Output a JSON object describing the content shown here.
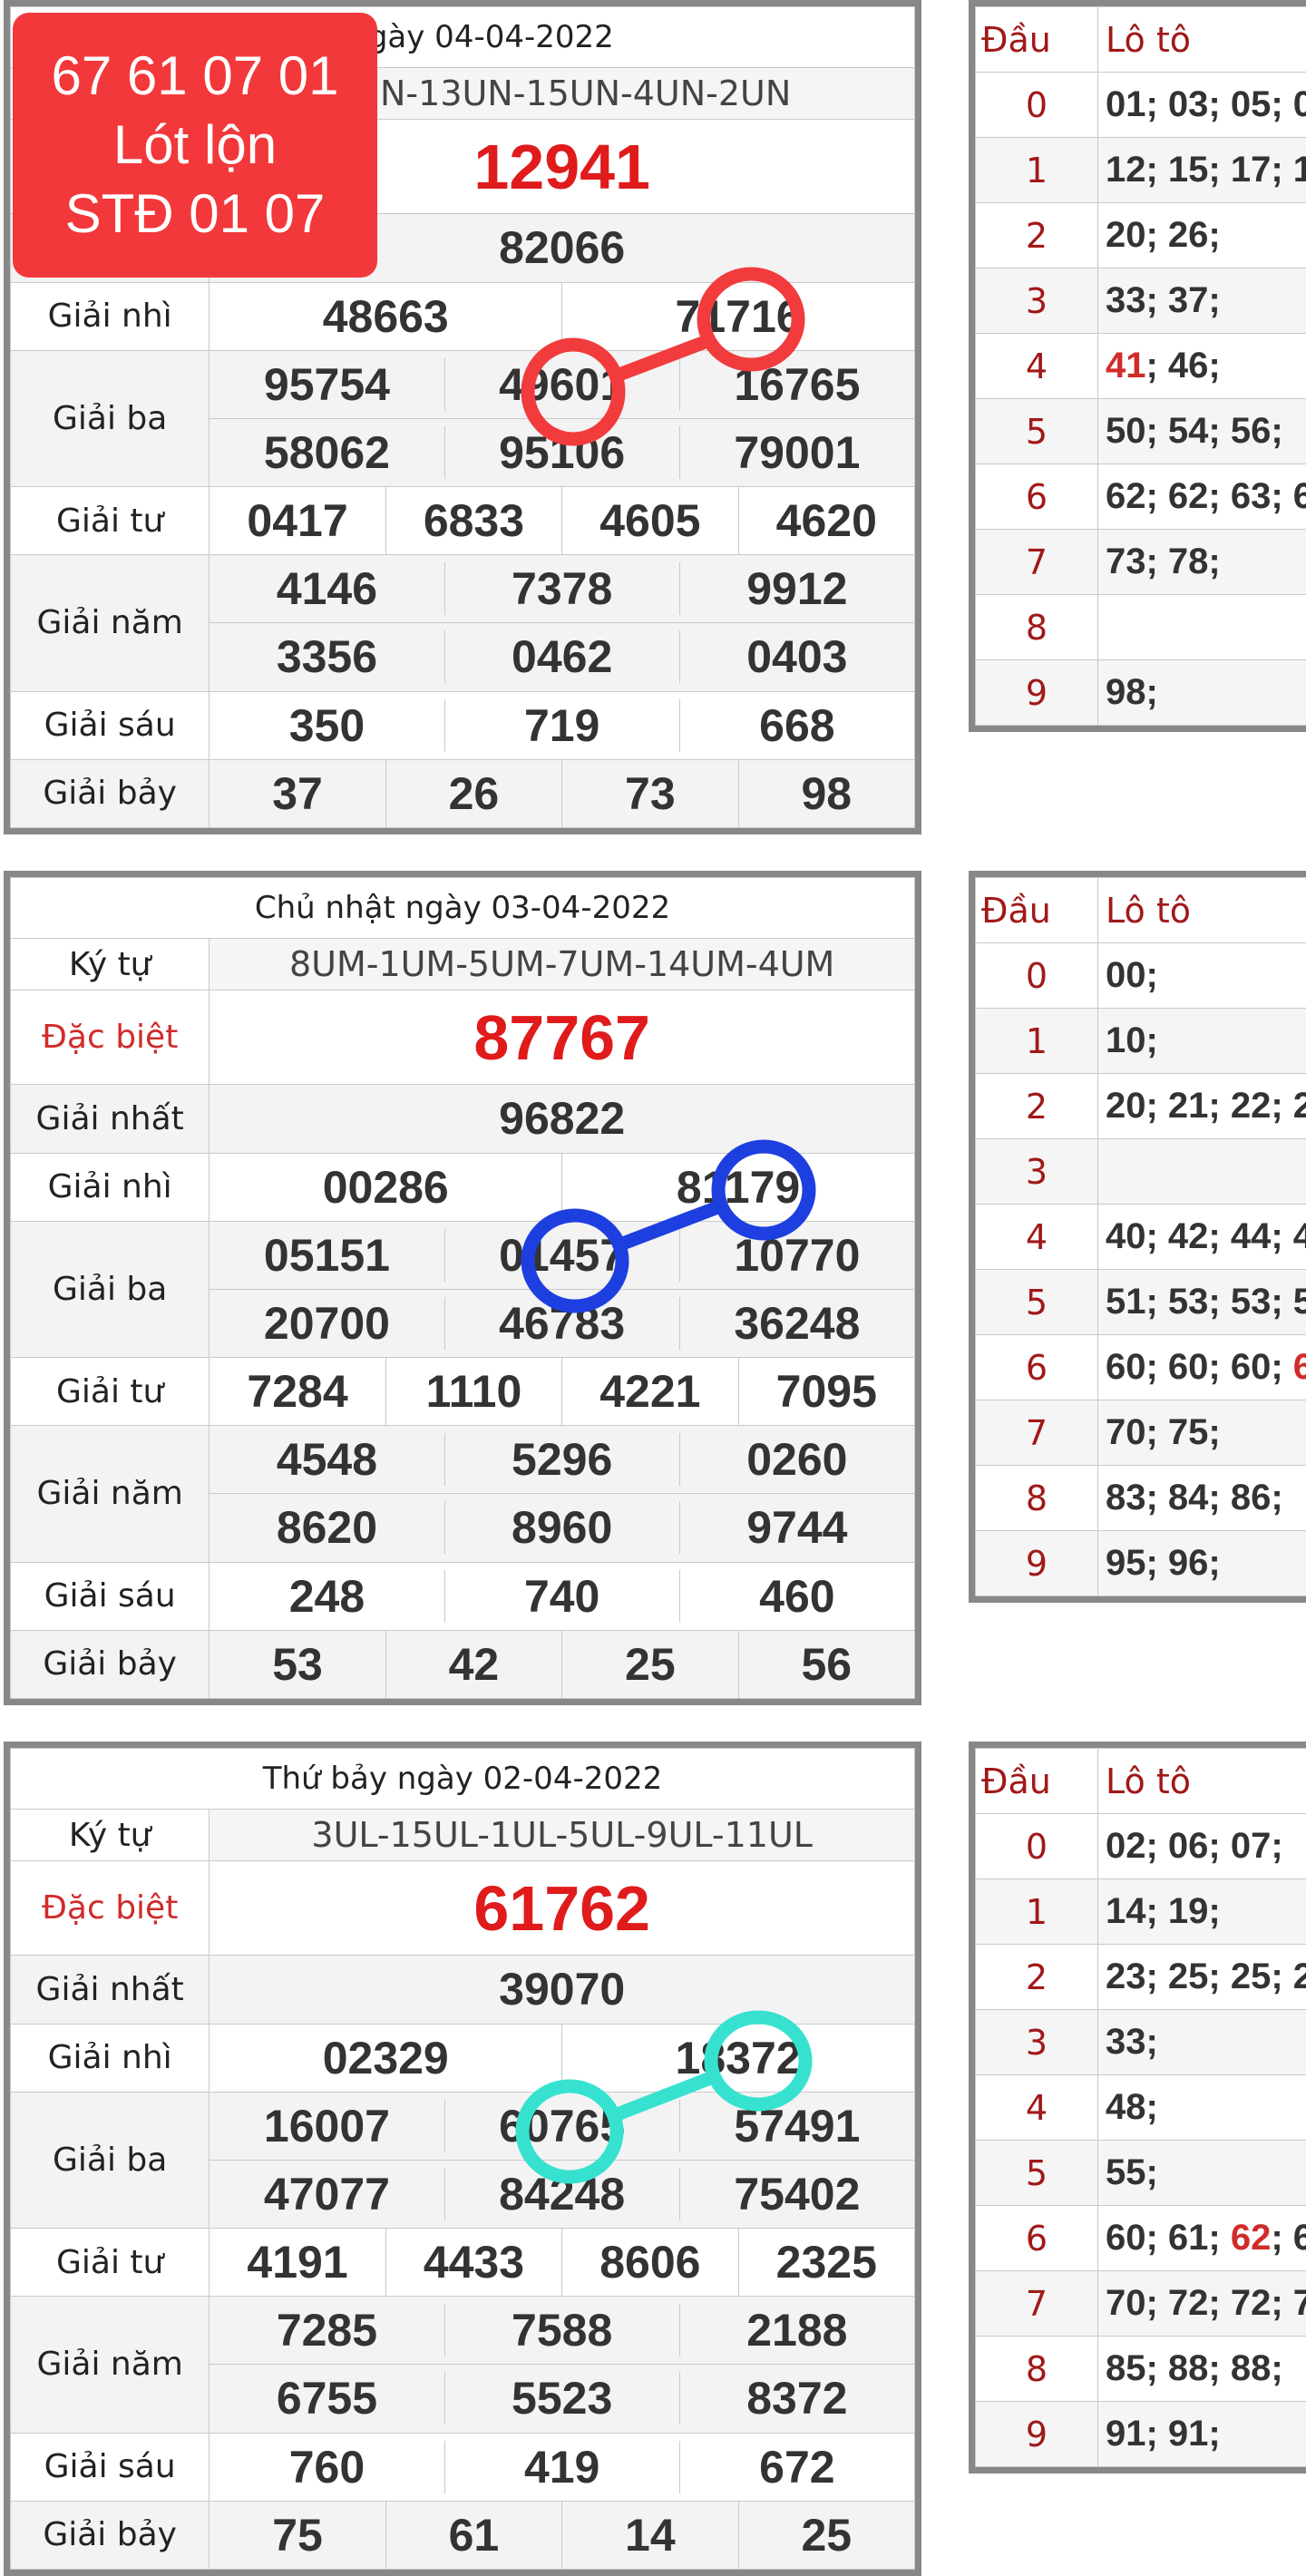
{
  "promo": {
    "line1": "67 61 07 01",
    "line2": "Lót lộn",
    "line3": "STĐ 01 07"
  },
  "labels": {
    "ky_tu": "Ký tự",
    "dac_biet": "Đặc biệt",
    "giai_nhat": "Giải nhất",
    "giai_nhi": "Giải nhì",
    "giai_ba": "Giải ba",
    "giai_tu": "Giải tư",
    "giai_nam": "Giải năm",
    "giai_sau": "Giải sáu",
    "giai_bay": "Giải bảy",
    "dau": "Đầu",
    "loto": "Lô tô"
  },
  "colors": {
    "circle_1": "#f23b3d",
    "circle_2": "#1e3fe0",
    "circle_3": "#36e2cf",
    "special": "#e01b1b",
    "label_red": "#d12b2b"
  },
  "draws": [
    {
      "title": "ai ngày 04-04-2022",
      "ky_tu": "8UN-13UN-15UN-4UN-2UN",
      "dac_biet": "12941",
      "giai_nhat": "82066",
      "giai_nhi": [
        "48663",
        "71716"
      ],
      "giai_ba": [
        "95754",
        "49601",
        "16765",
        "58062",
        "95106",
        "79001"
      ],
      "giai_tu": [
        "0417",
        "6833",
        "4605",
        "4620"
      ],
      "giai_nam": [
        "4146",
        "7378",
        "9912",
        "3356",
        "0462",
        "0403"
      ],
      "giai_sau": [
        "350",
        "719",
        "668"
      ],
      "giai_bay": [
        "37",
        "26",
        "73",
        "98"
      ],
      "loto": [
        "01; 03; 05; 0",
        "12; 15; 17; 1",
        "20; 26;",
        "33; 37;",
        "41; 46;",
        "50; 54; 56;",
        "62; 62; 63; 6",
        "73; 78;",
        "",
        "98;"
      ],
      "loto_hl": [
        "",
        "",
        "",
        "",
        "41",
        "",
        "",
        "",
        "",
        ""
      ],
      "loto_rest": [
        "",
        "",
        "",
        "",
        "; 46;",
        "",
        "",
        "",
        "",
        ""
      ]
    },
    {
      "title": "Chủ nhật ngày 03-04-2022",
      "ky_tu": "8UM-1UM-5UM-7UM-14UM-4UM",
      "dac_biet": "87767",
      "giai_nhat": "96822",
      "giai_nhi": [
        "00286",
        "81179"
      ],
      "giai_ba": [
        "05151",
        "01457",
        "10770",
        "20700",
        "46783",
        "36248"
      ],
      "giai_tu": [
        "7284",
        "1110",
        "4221",
        "7095"
      ],
      "giai_nam": [
        "4548",
        "5296",
        "0260",
        "8620",
        "8960",
        "9744"
      ],
      "giai_sau": [
        "248",
        "740",
        "460"
      ],
      "giai_bay": [
        "53",
        "42",
        "25",
        "56"
      ],
      "loto": [
        "00;",
        "10;",
        "20; 21; 22; 2",
        "",
        "40; 42; 44; 4",
        "51; 53; 53; 5",
        "60; 60; 60; ",
        "70; 75;",
        "83; 84; 86;",
        "95; 96;"
      ],
      "loto_hl": [
        "",
        "",
        "",
        "",
        "",
        "",
        "6",
        "",
        "",
        ""
      ],
      "loto_rest": [
        "",
        "",
        "",
        "",
        "",
        "",
        "",
        "",
        "",
        ""
      ]
    },
    {
      "title": "Thứ bảy ngày 02-04-2022",
      "ky_tu": "3UL-15UL-1UL-5UL-9UL-11UL",
      "dac_biet": "61762",
      "giai_nhat": "39070",
      "giai_nhi": [
        "02329",
        "18372"
      ],
      "giai_ba": [
        "16007",
        "60765",
        "57491",
        "47077",
        "84248",
        "75402"
      ],
      "giai_tu": [
        "4191",
        "4433",
        "8606",
        "2325"
      ],
      "giai_nam": [
        "7285",
        "7588",
        "2188",
        "6755",
        "5523",
        "8372"
      ],
      "giai_sau": [
        "760",
        "419",
        "672"
      ],
      "giai_bay": [
        "75",
        "61",
        "14",
        "25"
      ],
      "loto": [
        "02; 06; 07;",
        "14; 19;",
        "23; 25; 25; 2",
        "33;",
        "48;",
        "55;",
        "60; 61; ",
        "70; 72; 72; 7",
        "85; 88; 88;",
        "91; 91;"
      ],
      "loto_hl": [
        "",
        "",
        "",
        "",
        "",
        "",
        "62",
        "",
        "",
        ""
      ],
      "loto_rest": [
        "",
        "",
        "",
        "",
        "",
        "",
        "; 6",
        "",
        "",
        ""
      ]
    }
  ]
}
